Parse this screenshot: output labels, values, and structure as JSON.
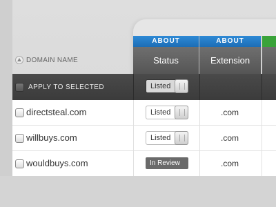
{
  "columns": {
    "domain_header": "DOMAIN NAME",
    "status": {
      "band": "ABOUT",
      "title": "Status"
    },
    "extension": {
      "band": "ABOUT",
      "title": "Extension"
    }
  },
  "colors": {
    "band_blue": "#1c6db6",
    "band_green": "#3aa33a",
    "header_dark": "#555555"
  },
  "bulk": {
    "label": "APPLY TO SELECTED",
    "status": "Listed"
  },
  "rows": [
    {
      "domain": "directsteal.com",
      "status": "Listed",
      "extension": ".com"
    },
    {
      "domain": "willbuys.com",
      "status": "Listed",
      "extension": ".com"
    },
    {
      "domain": "wouldbuys.com",
      "status": "In Review",
      "extension": ".com"
    }
  ]
}
